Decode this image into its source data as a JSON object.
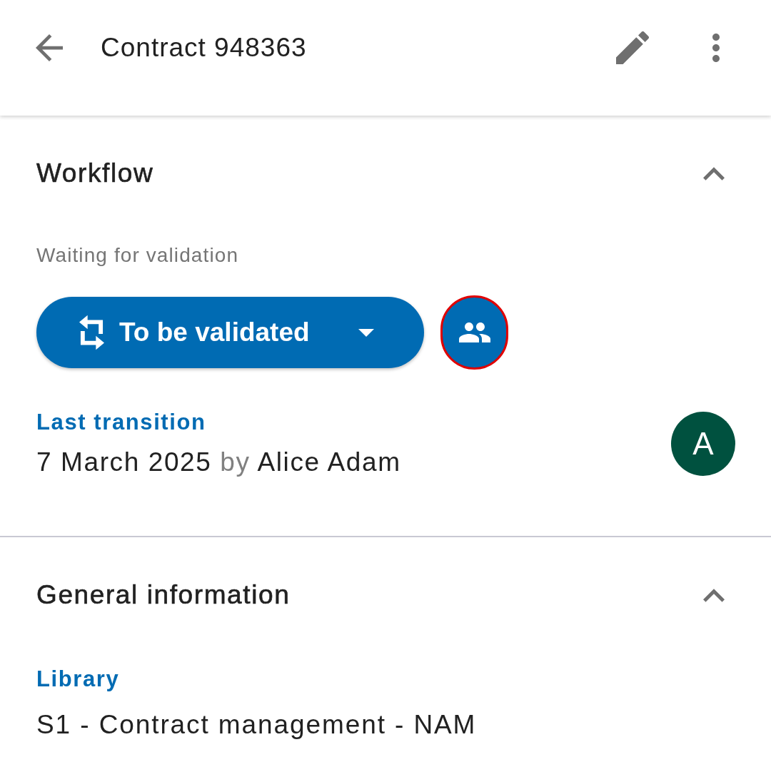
{
  "app_bar": {
    "title": "Contract 948363"
  },
  "sections": [
    {
      "kind": "workflow",
      "title": "Workflow",
      "expanded": true,
      "status_text": "Waiting for validation",
      "state_button": {
        "label": "To be validated"
      },
      "group_button": {
        "focused": true
      },
      "last_transition": {
        "label": "Last transition",
        "date": "7 March 2025",
        "by": "by",
        "person": "Alice Adam",
        "avatar": "A"
      }
    },
    {
      "kind": "info",
      "title": "General information",
      "expanded": true,
      "fields": [
        {
          "label": "Library",
          "value": "S1 - Contract management - NAM"
        }
      ]
    }
  ]
}
